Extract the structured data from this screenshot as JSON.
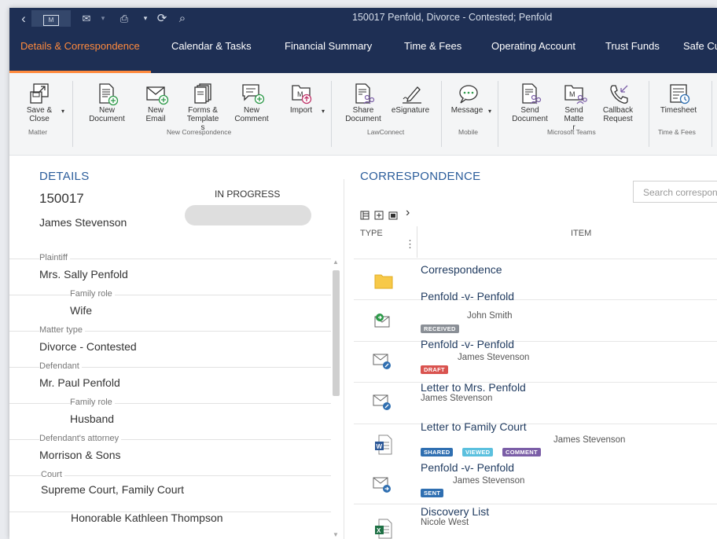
{
  "window": {
    "title": "150017 Penfold, Divorce - Contested; Penfold"
  },
  "titlebar": {
    "back": "‹",
    "m_label": "M",
    "mail": "✉",
    "print": "⎙",
    "more": "▾",
    "refresh": "⟳",
    "search": "⌕"
  },
  "nav": {
    "tabs": [
      "Details & Correspondence",
      "Calendar & Tasks",
      "Financial Summary",
      "Time & Fees",
      "Operating Account",
      "Trust Funds",
      "Safe Cu"
    ]
  },
  "ribbon": {
    "buttons": [
      "Save &\nClose",
      "New\nDocument",
      "New\nEmail",
      "Forms &\nTemplate\ns",
      "New\nComment",
      "Import",
      "Share\nDocument",
      "eSignature",
      "Message",
      "Send\nDocument",
      "Send\nMatte\nr",
      "Callback\nRequest",
      "Timesheet"
    ],
    "groups": [
      "Matter",
      "New Correspondence",
      "LawConnect",
      "Mobile",
      "Microsoft Teams",
      "Time & Fees"
    ],
    "dropdown_arrow": "▾"
  },
  "details": {
    "title": "DETAILS",
    "matter_number": "150017",
    "client": "James Stevenson",
    "status": "IN PROGRESS",
    "fields": [
      {
        "label": "Plaintiff",
        "value": "Mrs. Sally Penfold"
      },
      {
        "label": "Family role",
        "value": "Wife"
      },
      {
        "label": "Matter type",
        "value": "Divorce - Contested"
      },
      {
        "label": "Defendant",
        "value": "Mr. Paul Penfold"
      },
      {
        "label": "Family role",
        "value": "Husband"
      },
      {
        "label": "Defendant's attorney",
        "value": "Morrison & Sons"
      },
      {
        "label": "Court",
        "value": "Supreme Court, Family Court"
      },
      {
        "label": "",
        "value": "Honorable Kathleen Thompson"
      }
    ]
  },
  "correspondence": {
    "title": "CORRESPONDENCE",
    "search_placeholder": "Search correspondence",
    "columns": {
      "type": "TYPE",
      "item": "ITEM"
    },
    "toolbar_chevron": "›",
    "col_menu": "⋮",
    "items": [
      {
        "title": "Correspondence",
        "icon": "folder-icon"
      },
      {
        "title": "Penfold -v- Penfold",
        "sub": "John Smith",
        "badges": [
          "RECEIVED"
        ],
        "icon": "email-received-icon"
      },
      {
        "title": "Penfold -v- Penfold",
        "sub": "James Stevenson",
        "badges": [
          "DRAFT"
        ],
        "icon": "email-draft-icon"
      },
      {
        "title": "Letter to Mrs. Penfold",
        "sub": "James Stevenson",
        "icon": "email-draft-icon"
      },
      {
        "title": "Letter to Family Court",
        "sub": "James Stevenson",
        "badges": [
          "SHARED",
          "VIEWED",
          "COMMENT"
        ],
        "icon": "word-document-icon"
      },
      {
        "title": "Penfold -v- Penfold",
        "sub": "James Stevenson",
        "badges": [
          "SENT"
        ],
        "icon": "email-sent-icon"
      },
      {
        "title": "Discovery List",
        "sub": "Nicole West",
        "icon": "excel-document-icon"
      }
    ]
  },
  "colors": {
    "nav_bg": "#1e2f54",
    "accent_orange": "#ff8a3d",
    "heading_blue": "#2b5d9b",
    "badge_received": "#8a8f96",
    "badge_draft": "#d9534f",
    "badge_shared": "#2f6fb1",
    "badge_viewed": "#5bc0de",
    "badge_comment": "#7b5ea7",
    "badge_sent": "#2f6fb1"
  }
}
